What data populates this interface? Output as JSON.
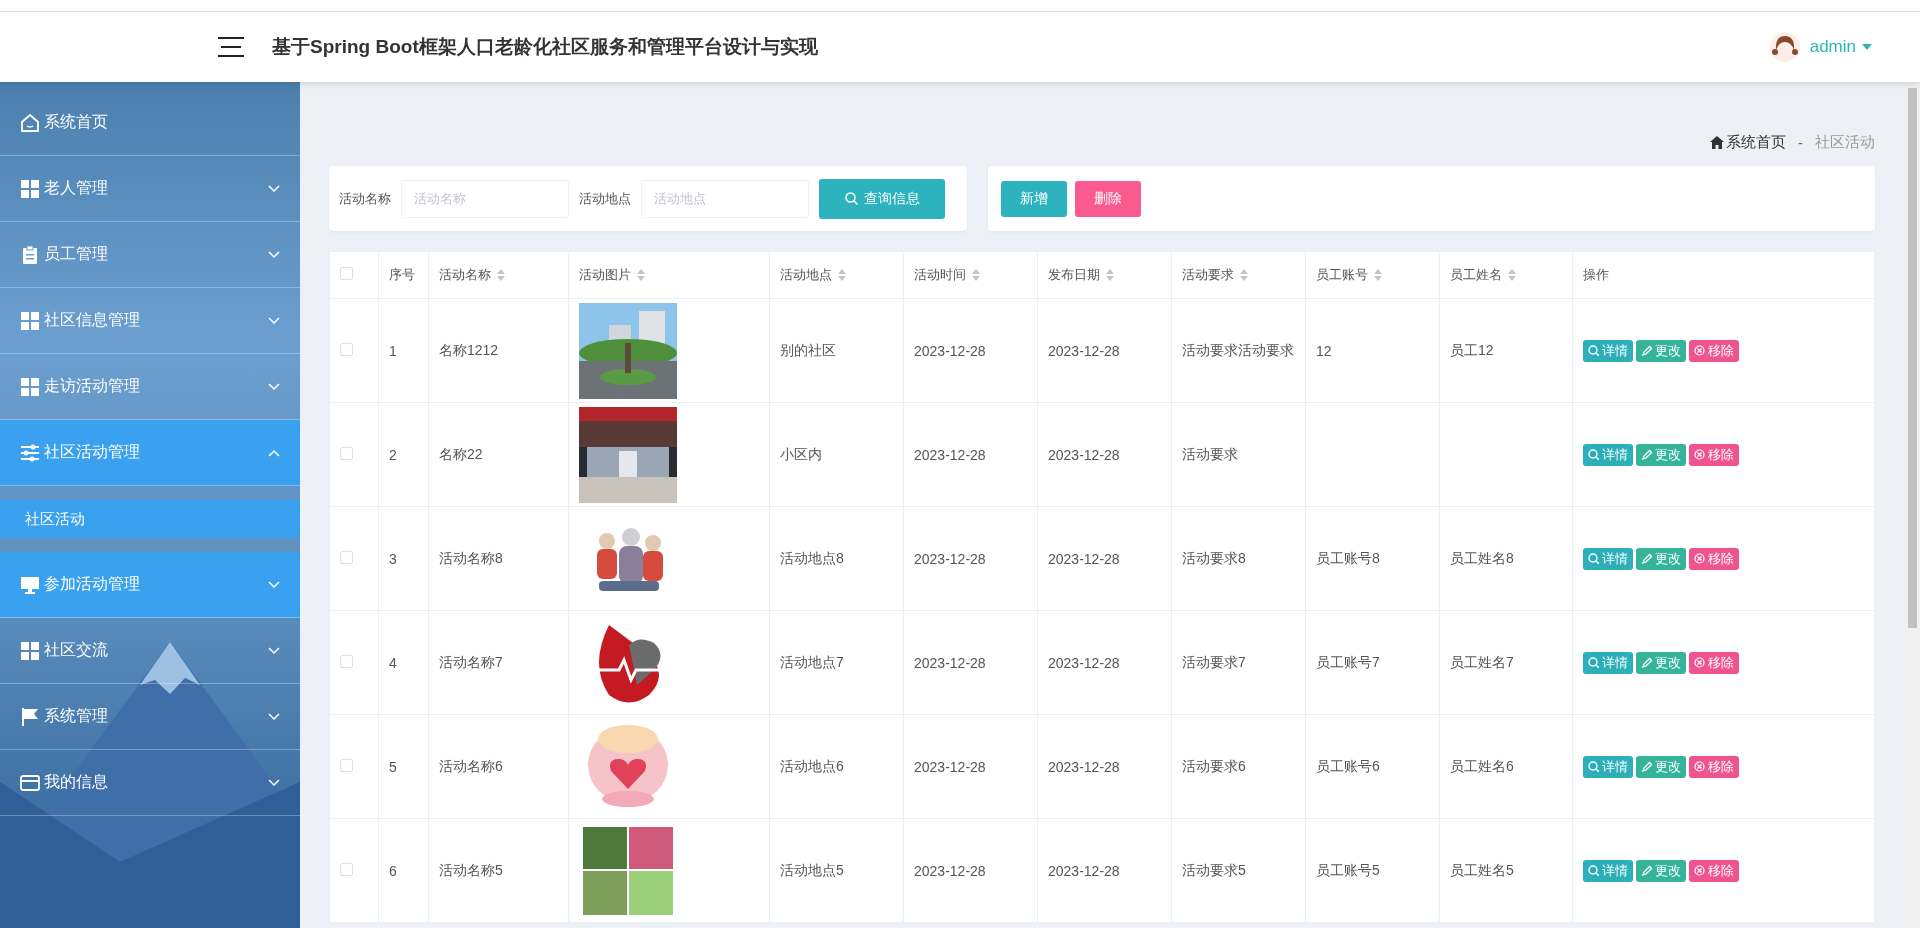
{
  "header": {
    "title": "基于Spring Boot框架人口老龄化社区服务和管理平台设计与实现",
    "user": "admin"
  },
  "sidebar": {
    "items": [
      {
        "label": "系统首页",
        "highlighted": false
      },
      {
        "label": "老人管理",
        "expanded": false,
        "highlighted": false
      },
      {
        "label": "员工管理",
        "expanded": false,
        "highlighted": false
      },
      {
        "label": "社区信息管理",
        "expanded": false,
        "highlighted": false
      },
      {
        "label": "走访活动管理",
        "expanded": false,
        "highlighted": false
      },
      {
        "label": "社区活动管理",
        "expanded": true,
        "highlighted": true,
        "children": [
          {
            "label": "社区活动",
            "selected": true
          }
        ]
      },
      {
        "label": "参加活动管理",
        "expanded": false,
        "highlighted": true
      },
      {
        "label": "社区交流",
        "expanded": false,
        "highlighted": false
      },
      {
        "label": "系统管理",
        "expanded": false,
        "highlighted": false
      },
      {
        "label": "我的信息",
        "expanded": false,
        "highlighted": false
      }
    ]
  },
  "breadcrumb": {
    "home": "系统首页",
    "separator": "-",
    "current": "社区活动"
  },
  "search": {
    "fields": [
      {
        "label": "活动名称",
        "placeholder": "活动名称"
      },
      {
        "label": "活动地点",
        "placeholder": "活动地点"
      }
    ],
    "button": "查询信息"
  },
  "actions": [
    {
      "label": "新增",
      "kind": "add"
    },
    {
      "label": "删除",
      "kind": "delete"
    }
  ],
  "table": {
    "select_all": {
      "checked": false
    },
    "columns": [
      {
        "label": "序号",
        "sortable": false
      },
      {
        "label": "活动名称",
        "sortable": true
      },
      {
        "label": "活动图片",
        "sortable": true
      },
      {
        "label": "活动地点",
        "sortable": true
      },
      {
        "label": "活动时间",
        "sortable": true
      },
      {
        "label": "发布日期",
        "sortable": true
      },
      {
        "label": "活动要求",
        "sortable": true
      },
      {
        "label": "员工账号",
        "sortable": true
      },
      {
        "label": "员工姓名",
        "sortable": true
      },
      {
        "label": "操作",
        "sortable": false
      }
    ],
    "rows": [
      {
        "checked": false,
        "index": "1",
        "name": "名称1212",
        "place": "别的社区",
        "time": "2023-12-28",
        "date": "2023-12-28",
        "requirement": "活动要求活动要求",
        "staff_account": "12",
        "staff_name": "员工12",
        "actions": [
          {
            "label": "详情",
            "kind": "detail"
          },
          {
            "label": "更改",
            "kind": "edit"
          },
          {
            "label": "移除",
            "kind": "remove"
          }
        ]
      },
      {
        "checked": false,
        "index": "2",
        "name": "名称22",
        "place": "小区内",
        "time": "2023-12-28",
        "date": "2023-12-28",
        "requirement": "活动要求",
        "actions": [
          {
            "label": "详情",
            "kind": "detail"
          },
          {
            "label": "更改",
            "kind": "edit"
          },
          {
            "label": "移除",
            "kind": "remove"
          }
        ]
      },
      {
        "checked": false,
        "index": "3",
        "name": "活动名称8",
        "place": "活动地点8",
        "time": "2023-12-28",
        "date": "2023-12-28",
        "requirement": "活动要求8",
        "staff_account": "员工账号8",
        "staff_name": "员工姓名8",
        "actions": [
          {
            "label": "详情",
            "kind": "detail"
          },
          {
            "label": "更改",
            "kind": "edit"
          },
          {
            "label": "移除",
            "kind": "remove"
          }
        ]
      },
      {
        "checked": false,
        "index": "4",
        "name": "活动名称7",
        "place": "活动地点7",
        "time": "2023-12-28",
        "date": "2023-12-28",
        "requirement": "活动要求7",
        "staff_account": "员工账号7",
        "staff_name": "员工姓名7",
        "actions": [
          {
            "label": "详情",
            "kind": "detail"
          },
          {
            "label": "更改",
            "kind": "edit"
          },
          {
            "label": "移除",
            "kind": "remove"
          }
        ]
      },
      {
        "checked": false,
        "index": "5",
        "name": "活动名称6",
        "place": "活动地点6",
        "time": "2023-12-28",
        "date": "2023-12-28",
        "requirement": "活动要求6",
        "staff_account": "员工账号6",
        "staff_name": "员工姓名6",
        "actions": [
          {
            "label": "详情",
            "kind": "detail"
          },
          {
            "label": "更改",
            "kind": "edit"
          },
          {
            "label": "移除",
            "kind": "remove"
          }
        ]
      },
      {
        "checked": false,
        "index": "6",
        "name": "活动名称5",
        "place": "活动地点5",
        "time": "2023-12-28",
        "date": "2023-12-28",
        "requirement": "活动要求5",
        "staff_account": "员工账号5",
        "staff_name": "员工姓名5",
        "actions": [
          {
            "label": "详情",
            "kind": "detail"
          },
          {
            "label": "更改",
            "kind": "edit"
          },
          {
            "label": "移除",
            "kind": "remove"
          }
        ]
      }
    ]
  }
}
